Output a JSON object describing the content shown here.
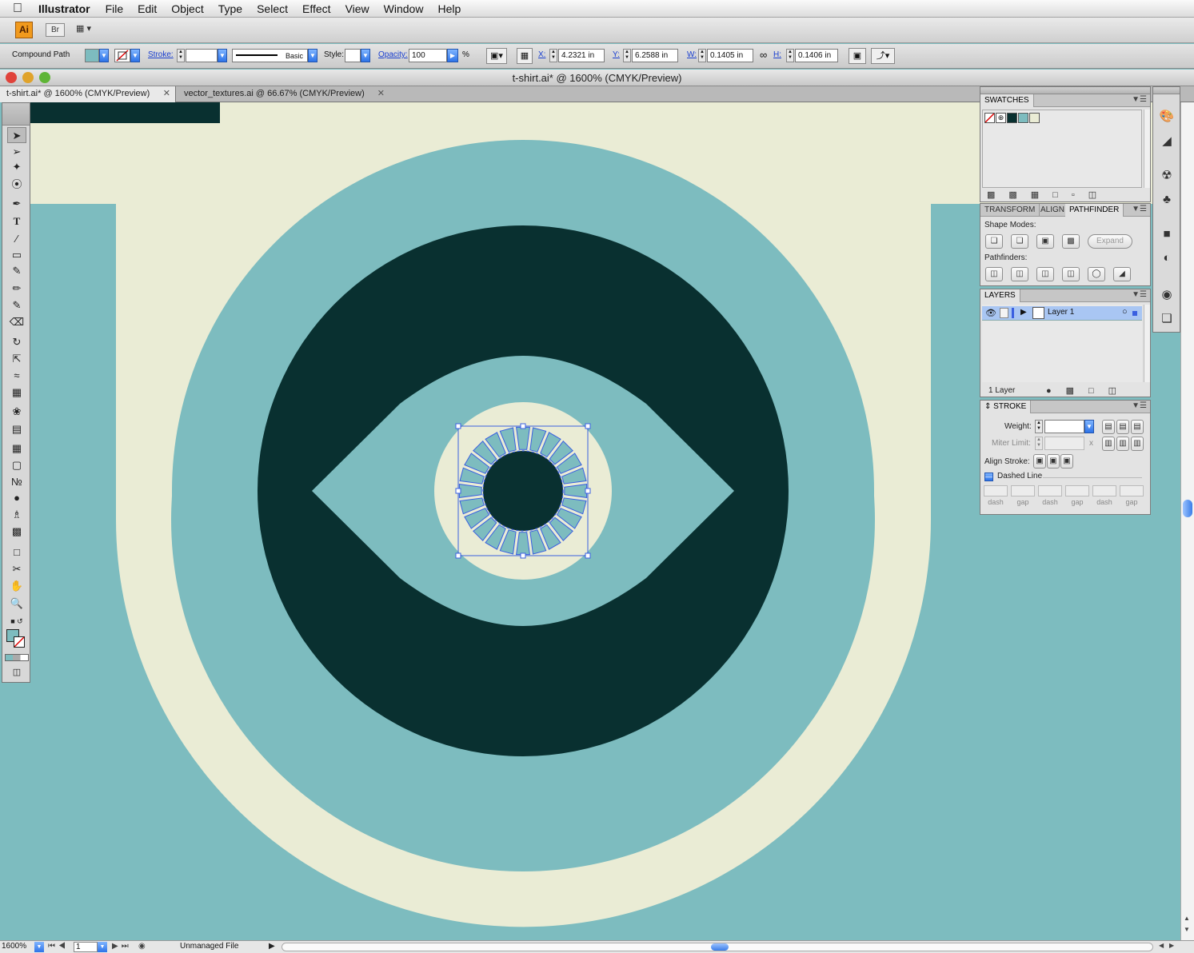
{
  "menubar": {
    "app_name": "Illustrator",
    "items": [
      "File",
      "Edit",
      "Object",
      "Type",
      "Select",
      "Effect",
      "View",
      "Window",
      "Help"
    ]
  },
  "appbar": {
    "logo": "Ai",
    "bridge": "Br"
  },
  "control": {
    "selection_type": "Compound Path",
    "stroke_label": "Stroke:",
    "brush_label": "Basic",
    "style_label": "Style:",
    "opacity_label": "Opacity:",
    "opacity_value": "100",
    "percent": "%",
    "x_label": "X:",
    "x_value": "4.2321 in",
    "y_label": "Y:",
    "y_value": "6.2588 in",
    "w_label": "W:",
    "w_value": "0.1405 in",
    "h_label": "H:",
    "h_value": "0.1406 in"
  },
  "window": {
    "title": "t-shirt.ai* @ 1600% (CMYK/Preview)"
  },
  "tabs": [
    {
      "label": "t-shirt.ai* @ 1600% (CMYK/Preview)"
    },
    {
      "label": "vector_textures.ai @ 66.67% (CMYK/Preview)"
    }
  ],
  "swatches": {
    "title": "SWATCHES"
  },
  "pathfinder": {
    "tabs": [
      "TRANSFORM",
      "ALIGN",
      "PATHFINDER"
    ],
    "shape_modes": "Shape Modes:",
    "expand": "Expand",
    "pathfinders": "Pathfinders:"
  },
  "layers": {
    "title": "LAYERS",
    "layer_name": "Layer 1",
    "count": "1 Layer"
  },
  "stroke": {
    "title": "STROKE",
    "weight": "Weight:",
    "miter": "Miter Limit:",
    "miter_x": "x",
    "align": "Align Stroke:",
    "dashed": "Dashed Line",
    "dash_labels": [
      "dash",
      "gap",
      "dash",
      "gap",
      "dash",
      "gap"
    ]
  },
  "status": {
    "zoom": "1600%",
    "page": "1",
    "file_state": "Unmanaged File"
  },
  "colors": {
    "cream": "#eaecd5",
    "teal": "#7dbcbf",
    "dark": "#093030",
    "selection": "#3a5fe0"
  }
}
